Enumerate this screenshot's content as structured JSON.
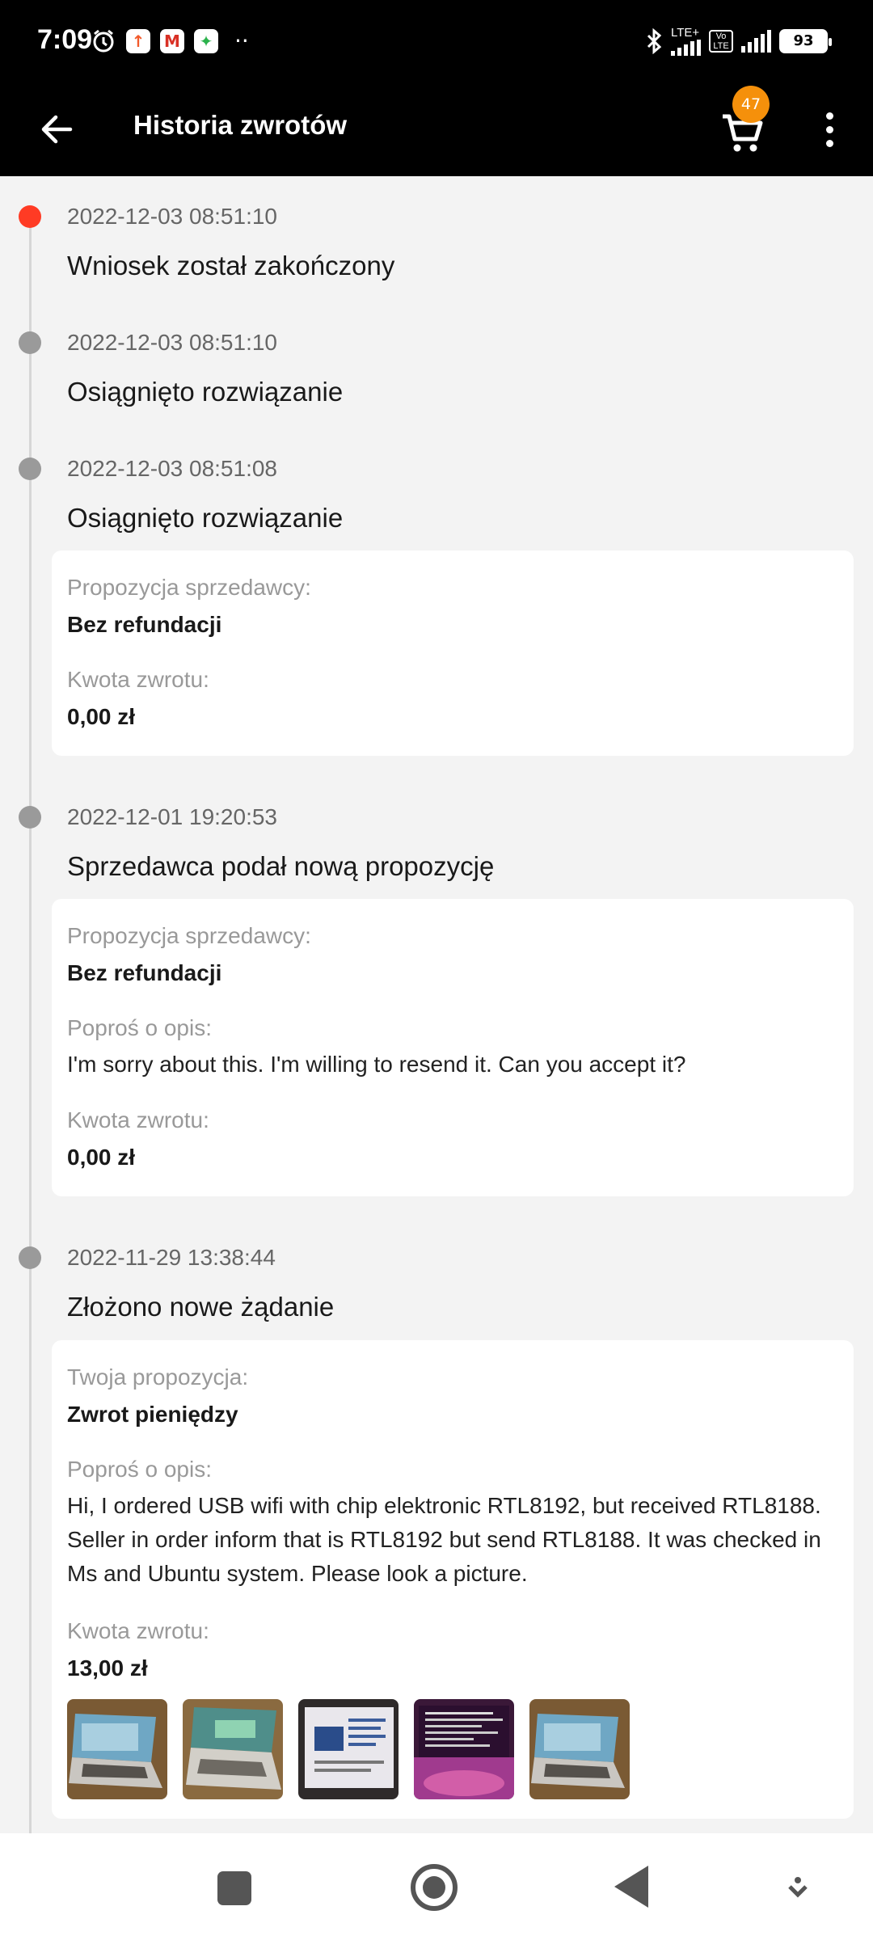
{
  "status_bar": {
    "time": "7:09",
    "network": "LTE+",
    "volte": "Vo LTE",
    "battery": "93"
  },
  "header": {
    "title": "Historia zwrotów",
    "cart_count": "47"
  },
  "timeline": [
    {
      "date": "2022-12-03 08:51:10",
      "title": "Wniosek został zakończony",
      "active": true
    },
    {
      "date": "2022-12-03 08:51:10",
      "title": "Osiągnięto rozwiązanie"
    },
    {
      "date": "2022-12-03 08:51:08",
      "title": "Osiągnięto rozwiązanie",
      "card": {
        "proposal_label": "Propozycja sprzedawcy:",
        "proposal_value": "Bez refundacji",
        "amount_label": "Kwota zwrotu:",
        "amount_value": "0,00 zł"
      }
    },
    {
      "date": "2022-12-01 19:20:53",
      "title": "Sprzedawca podał nową propozycję",
      "card": {
        "proposal_label": "Propozycja sprzedawcy:",
        "proposal_value": "Bez refundacji",
        "description_label": "Poproś o opis:",
        "description_value": "I'm sorry about this. I'm willing to resend it. Can you accept it?",
        "amount_label": "Kwota zwrotu:",
        "amount_value": "0,00 zł"
      }
    },
    {
      "date": "2022-11-29 13:38:44",
      "title": "Złożono nowe żądanie",
      "card": {
        "proposal_label": "Twoja propozycja:",
        "proposal_value": "Zwrot pieniędzy",
        "description_label": "Poproś o opis:",
        "description_value": "Hi, I ordered USB wifi with chip elektronic RTL8192, but received RTL8188. Seller in order inform that is RTL8192 but send RTL8188. It was checked in Ms and Ubuntu system. Please look a picture.",
        "amount_label": "Kwota zwrotu:",
        "amount_value": "13,00 zł",
        "photos": [
          "laptop-photo",
          "laptop-photo",
          "screen-photo",
          "terminal-photo",
          "laptop-photo"
        ]
      }
    }
  ],
  "colors": {
    "accent_dot": "#ff3b24",
    "badge": "#f5900b",
    "header_bg": "#000000"
  }
}
